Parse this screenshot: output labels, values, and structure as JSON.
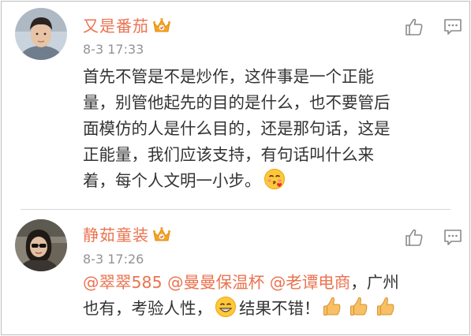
{
  "comments": [
    {
      "username": "又是番茄",
      "badge_icon": "crown-icon",
      "timestamp": "8-3 17:33",
      "text_lines": [
        "首先不管是不是炒作，这件事是一个正能",
        "量，别管他起先的目的是什么，也不要管后",
        "面模仿的人是什么目的，还是那句话，这是",
        "正能量，我们应该支持，有句话叫什么来",
        "着，每个人文明一小步。"
      ],
      "trailing_emoji": "kiss-face-emoji",
      "like_icon": "thumb-up-outline-icon",
      "reply_icon": "comment-bubble-icon"
    },
    {
      "username": "静茹童装",
      "badge_icon": "crown-icon",
      "timestamp": "8-3 17:26",
      "mentions": [
        "@翠翠585",
        "@曼曼保温杯",
        "@老谭电商"
      ],
      "text_after_mentions": "，广州",
      "line2_text": "也有，考验人性，",
      "line2_emoji": "grin-face-emoji",
      "line2_after_emoji": "结果不错！",
      "line2_trailing_emojis": [
        "thumbs-up-emoji",
        "thumbs-up-emoji",
        "thumbs-up-emoji"
      ],
      "like_icon": "thumb-up-outline-icon",
      "reply_icon": "comment-bubble-icon"
    }
  ],
  "colors": {
    "username": "#eb7350",
    "mention": "#eb7350",
    "timestamp": "#939393",
    "body": "#333333",
    "crown": "#f5a623"
  }
}
